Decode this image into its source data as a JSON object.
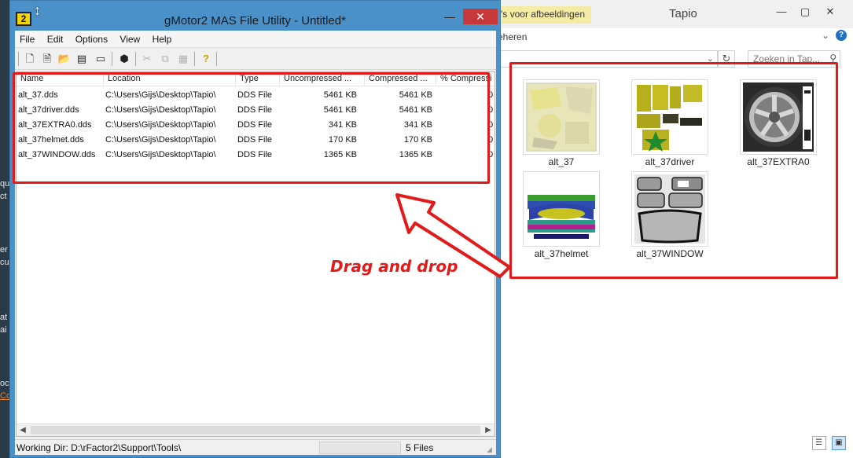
{
  "left_sliver": {
    "fragments": [
      "qu",
      "ct",
      "er",
      "cu",
      "at",
      "ai",
      "oc",
      "Co"
    ]
  },
  "mas_window": {
    "title": "gMotor2 MAS File Utility - Untitled*",
    "app_icon_text": "2",
    "minimize": "—",
    "close": "✕",
    "menu": [
      "File",
      "Edit",
      "Options",
      "View",
      "Help"
    ],
    "toolbar_icons": [
      "new-file-icon",
      "add-file-icon",
      "open-folder-icon",
      "save-icon",
      "export-icon",
      "package-icon",
      "cut-icon",
      "copy-icon",
      "paste-icon",
      "help-icon"
    ],
    "columns": [
      "Name",
      "Location",
      "Type",
      "Uncompressed ...",
      "Compressed ...",
      "% Compressi"
    ],
    "rows": [
      {
        "name": "alt_37.dds",
        "location": "C:\\Users\\Gijs\\Desktop\\Tapio\\",
        "type": "DDS File",
        "uncompressed": "5461 KB",
        "compressed": "5461 KB",
        "percent": "0"
      },
      {
        "name": "alt_37driver.dds",
        "location": "C:\\Users\\Gijs\\Desktop\\Tapio\\",
        "type": "DDS File",
        "uncompressed": "5461 KB",
        "compressed": "5461 KB",
        "percent": "0"
      },
      {
        "name": "alt_37EXTRA0.dds",
        "location": "C:\\Users\\Gijs\\Desktop\\Tapio\\",
        "type": "DDS File",
        "uncompressed": "341 KB",
        "compressed": "341 KB",
        "percent": "0"
      },
      {
        "name": "alt_37helmet.dds",
        "location": "C:\\Users\\Gijs\\Desktop\\Tapio\\",
        "type": "DDS File",
        "uncompressed": "170 KB",
        "compressed": "170 KB",
        "percent": "0"
      },
      {
        "name": "alt_37WINDOW.dds",
        "location": "C:\\Users\\Gijs\\Desktop\\Tapio\\",
        "type": "DDS File",
        "uncompressed": "1365 KB",
        "compressed": "1365 KB",
        "percent": "0"
      }
    ],
    "status": {
      "working_dir": "Working Dir: D:\\rFactor2\\Support\\Tools\\",
      "file_count": "5 Files"
    }
  },
  "explorer": {
    "title": "Tapio",
    "tab_text": "'s voor afbeeldingen",
    "ribbon_text": "eheren",
    "search_placeholder": "Zoeken in Tap...",
    "help": "?",
    "thumbnails": [
      {
        "label": "alt_37"
      },
      {
        "label": "alt_37driver"
      },
      {
        "label": "alt_37EXTRA0"
      },
      {
        "label": "alt_37helmet"
      },
      {
        "label": "alt_37WINDOW"
      }
    ],
    "window_controls": [
      "—",
      "▢",
      "✕"
    ]
  },
  "annotation": {
    "drag_label": "Drag and drop",
    "color": "#e21a1a"
  }
}
